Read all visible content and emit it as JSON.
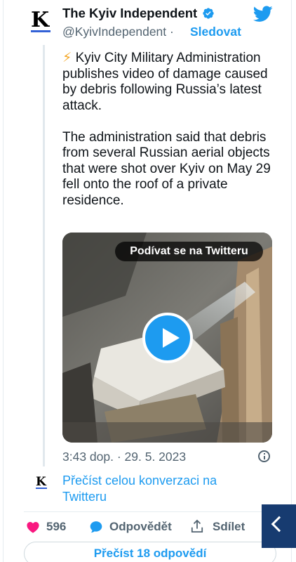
{
  "author": {
    "name": "The Kyiv Independent",
    "handle": "@KyivIndependent",
    "separator": "·",
    "follow_label": "Sledovat",
    "avatar_letter": "K",
    "avatar_bar_color": "#3361d6"
  },
  "tweet": {
    "bolt": "⚡",
    "paragraph_1": "Kyiv City Military Administration publishes video of damage caused by debris following Russia’s latest attack.",
    "paragraph_2": "The administration said that debris from several Russian aerial objects that were shot over Kyiv on May 29 fell onto the roof of a private residence.",
    "timestamp": "3:43 dop. · 29. 5. 2023"
  },
  "media": {
    "watch_label": "Podívat se na Twitteru",
    "play_icon": "play-icon"
  },
  "conversation": {
    "link_label": "Přečíst celou konverzaci na Twitteru"
  },
  "actions": {
    "like_count": "596",
    "reply_label": "Odpovědět",
    "share_label": "Sdílet"
  },
  "footer": {
    "read_replies_label": "Přečíst 18 odpovědí"
  },
  "colors": {
    "accent": "#1d9bf0",
    "like": "#f91880",
    "muted": "#536471",
    "back_tab": "#173b70"
  }
}
